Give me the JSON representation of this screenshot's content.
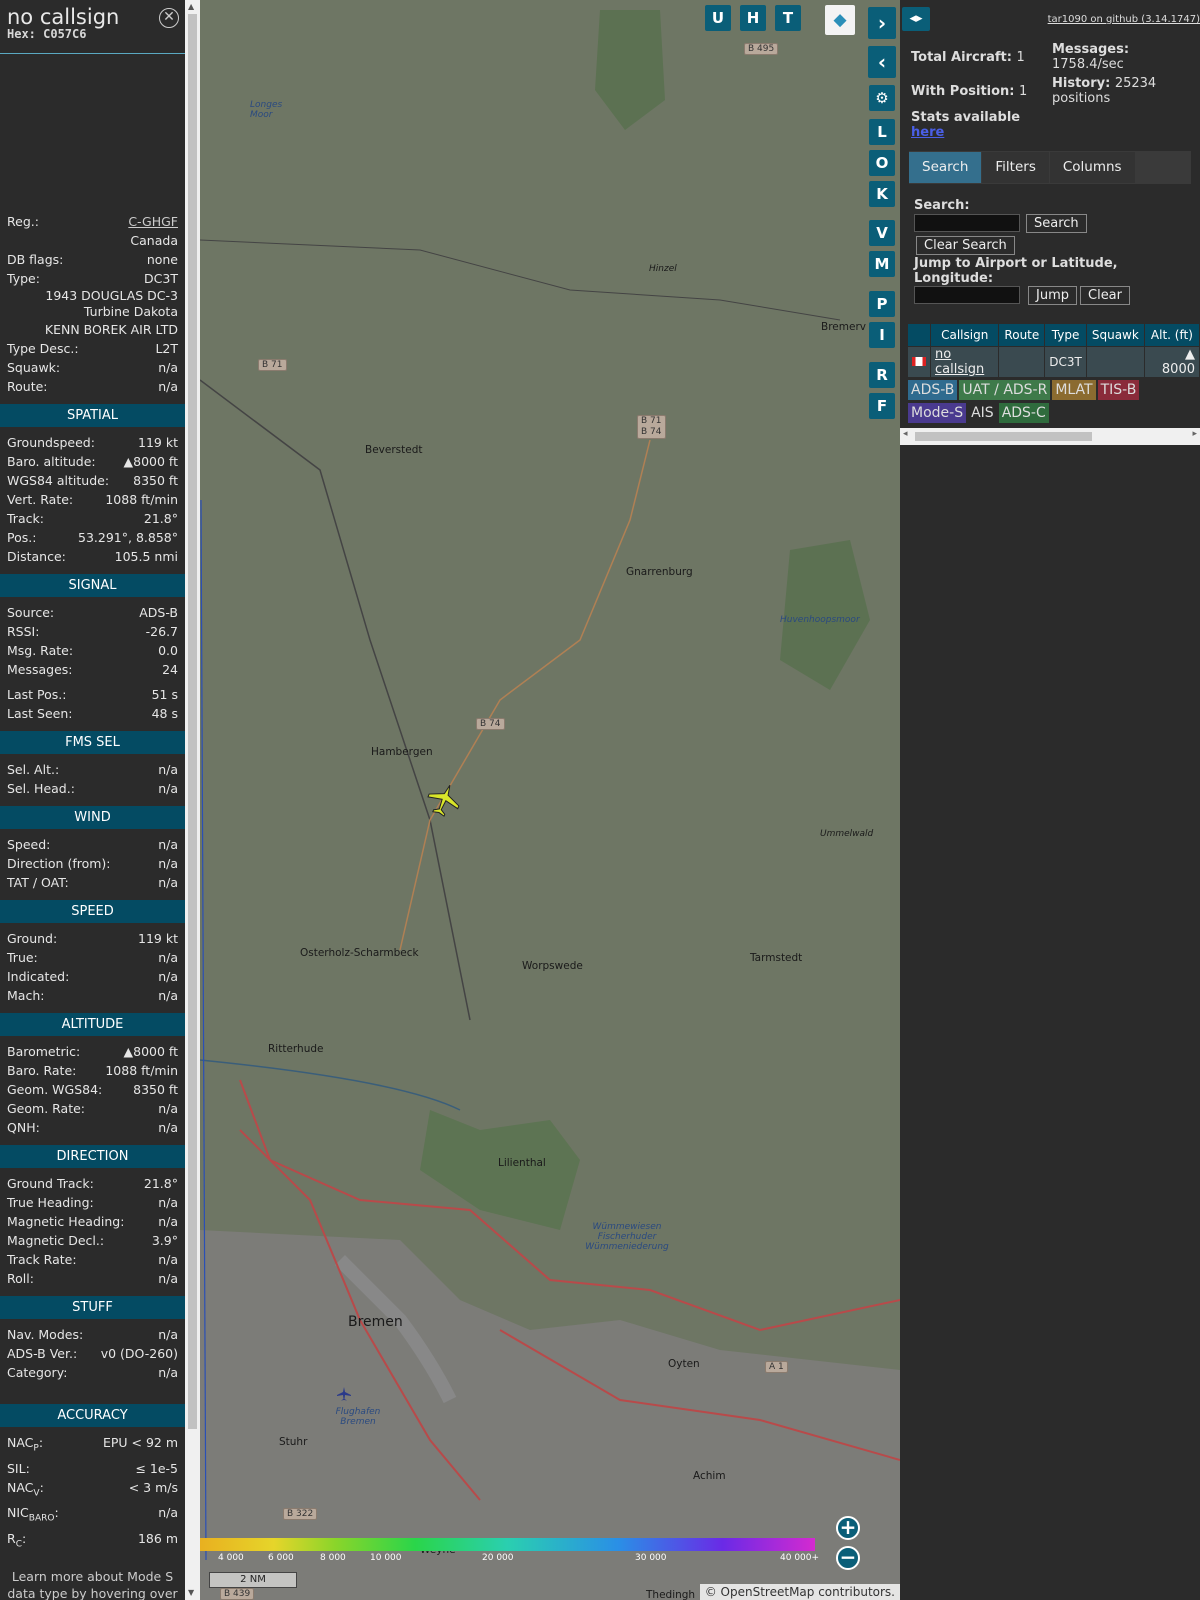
{
  "aircraft": {
    "callsign": "no callsign",
    "hex": "Hex: C057C6",
    "registration_label": "Reg.:",
    "registration": "C-GHGF",
    "country": "Canada",
    "dbflags_label": "DB flags:",
    "dbflags": "none",
    "type_label": "Type:",
    "type": "DC3T",
    "type_name_line1": "1943 DOUGLAS DC-3",
    "type_name_line2": "Turbine Dakota",
    "operator": "KENN BOREK AIR LTD",
    "type_desc_label": "Type Desc.:",
    "type_desc": "L2T",
    "squawk_label": "Squawk:",
    "squawk": "n/a",
    "route_label": "Route:",
    "route": "n/a"
  },
  "sections": {
    "spatial": "SPATIAL",
    "signal": "SIGNAL",
    "fms": "FMS SEL",
    "wind": "WIND",
    "speed": "SPEED",
    "altitude": "ALTITUDE",
    "direction": "DIRECTION",
    "stuff": "STUFF",
    "accuracy": "ACCURACY"
  },
  "spatial": [
    [
      "Groundspeed:",
      "119 kt"
    ],
    [
      "Baro. altitude:",
      "▲8000 ft"
    ],
    [
      "WGS84 altitude:",
      "8350 ft"
    ],
    [
      "Vert. Rate:",
      "1088 ft/min"
    ],
    [
      "Track:",
      "21.8°"
    ],
    [
      "Pos.:",
      "53.291°, 8.858°"
    ],
    [
      "Distance:",
      "105.5 nmi"
    ]
  ],
  "signal": [
    [
      "Source:",
      "ADS-B"
    ],
    [
      "RSSI:",
      "-26.7"
    ],
    [
      "Msg. Rate:",
      "0.0"
    ],
    [
      "Messages:",
      "24"
    ]
  ],
  "signal2": [
    [
      "Last Pos.:",
      "51 s"
    ],
    [
      "Last Seen:",
      "48 s"
    ]
  ],
  "fms": [
    [
      "Sel. Alt.:",
      "n/a"
    ],
    [
      "Sel. Head.:",
      "n/a"
    ]
  ],
  "wind": [
    [
      "Speed:",
      "n/a"
    ],
    [
      "Direction (from):",
      "n/a"
    ],
    [
      "TAT / OAT:",
      "n/a"
    ]
  ],
  "speed": [
    [
      "Ground:",
      "119 kt"
    ],
    [
      "True:",
      "n/a"
    ],
    [
      "Indicated:",
      "n/a"
    ],
    [
      "Mach:",
      "n/a"
    ]
  ],
  "altitude": [
    [
      "Barometric:",
      "▲8000 ft"
    ],
    [
      "Baro. Rate:",
      "1088 ft/min"
    ],
    [
      "Geom. WGS84:",
      "8350 ft"
    ],
    [
      "Geom. Rate:",
      "n/a"
    ],
    [
      "QNH:",
      "n/a"
    ]
  ],
  "direction": [
    [
      "Ground Track:",
      "21.8°"
    ],
    [
      "True Heading:",
      "n/a"
    ],
    [
      "Magnetic Heading:",
      "n/a"
    ],
    [
      "Magnetic Decl.:",
      "3.9°"
    ],
    [
      "Track Rate:",
      "n/a"
    ],
    [
      "Roll:",
      "n/a"
    ]
  ],
  "stuff": [
    [
      "Nav. Modes:",
      "n/a"
    ],
    [
      "ADS-B Ver.:",
      "v0 (DO-260)"
    ],
    [
      "Category:",
      "n/a"
    ]
  ],
  "accuracy": [
    [
      "NAC",
      "P",
      ":",
      "EPU < 92 m"
    ],
    [
      "SIL:",
      "",
      "",
      "≤ 1e-5"
    ],
    [
      "NAC",
      "V",
      ":",
      "< 3 m/s"
    ],
    [
      "NIC",
      "BARO",
      ":",
      "n/a"
    ],
    [
      "R",
      "C",
      ":",
      "186 m"
    ]
  ],
  "learn_more": "Learn more about Mode S data type by hovering over each data label.",
  "map": {
    "buttons_top": [
      "U",
      "H",
      "T"
    ],
    "side_buttons": [
      "L",
      "O",
      "K",
      "V",
      "M",
      "P",
      "I",
      "R",
      "F"
    ],
    "places": [
      "Beverstedt",
      "Gnarrenburg",
      "Hambergen",
      "Osterholz-Scharmbeck",
      "Worpswede",
      "Tarmstedt",
      "Ritterhude",
      "Lilienthal",
      "Bremen",
      "Oyten",
      "Achim",
      "Stuhr",
      "Bremerv",
      "Hinzel",
      "Ummelwald",
      "Huvenhoopsmoor",
      "Flughafen Bremen",
      "Wümmewiesen Fischerhuder Wümmeniederung",
      "Weyhe",
      "Longes Moor",
      "Thedingh"
    ],
    "roads": [
      "B 495",
      "B 71",
      "B 71",
      "B 74",
      "B 74",
      "A 1",
      "B 322",
      "B 439"
    ],
    "colorbar_labels": [
      "4 000",
      "6 000",
      "8 000",
      "10 000",
      "20 000",
      "30 000",
      "40 000+"
    ],
    "scale": "2 NM",
    "attribution": "© OpenStreetMap contributors.",
    "zoom_in": "+",
    "zoom_out": "−"
  },
  "right": {
    "github": "tar1090 on github (3.14.1747)",
    "total_label": "Total Aircraft:",
    "total": "1",
    "messages_label": "Messages:",
    "messages": "1758.4/sec",
    "position_label": "With Position:",
    "position": "1",
    "history_label": "History:",
    "history": "25234 positions",
    "stats_text": "Stats available",
    "stats_link": "here",
    "tabs": [
      "Search",
      "Filters",
      "Columns"
    ],
    "search_label": "Search:",
    "search_button": "Search",
    "clear_search": "Clear Search",
    "jump_label": "Jump to Airport or Latitude, Longitude:",
    "jump_button": "Jump",
    "clear_button": "Clear",
    "columns": [
      "Callsign",
      "Route",
      "Type",
      "Squawk",
      "Alt. (ft)"
    ],
    "row": {
      "callsign": "no callsign",
      "route": "",
      "type": "DC3T",
      "squawk": "",
      "alt": "▲ 8000"
    },
    "chips": [
      {
        "label": "ADS-B",
        "color": "#2f6b8f"
      },
      {
        "label": "UAT / ADS-R",
        "color": "#3e7a4a"
      },
      {
        "label": "MLAT",
        "color": "#8b6b30"
      },
      {
        "label": "TIS-B",
        "color": "#8a2b3a"
      },
      {
        "label": "Mode-S",
        "color": "#4a3a8f"
      },
      {
        "label": "AIS",
        "color": "#2b2b2b"
      },
      {
        "label": "ADS-C",
        "color": "#2f6b3d"
      }
    ]
  }
}
